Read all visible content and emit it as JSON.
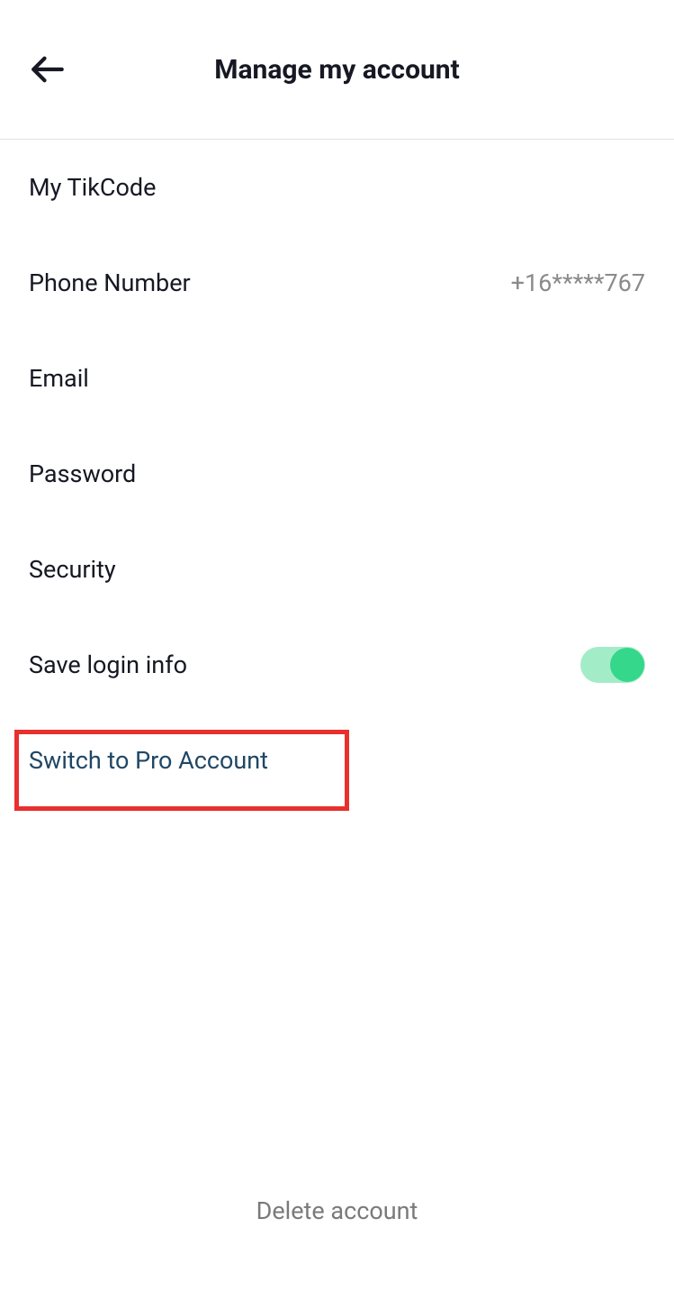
{
  "header": {
    "title": "Manage my account"
  },
  "items": {
    "tikcode": {
      "label": "My TikCode"
    },
    "phone": {
      "label": "Phone Number",
      "value": "+16*****767"
    },
    "email": {
      "label": "Email"
    },
    "password": {
      "label": "Password"
    },
    "security": {
      "label": "Security"
    },
    "save_login": {
      "label": "Save login info"
    },
    "switch_pro": {
      "label": "Switch to Pro Account"
    }
  },
  "footer": {
    "delete": "Delete account"
  }
}
